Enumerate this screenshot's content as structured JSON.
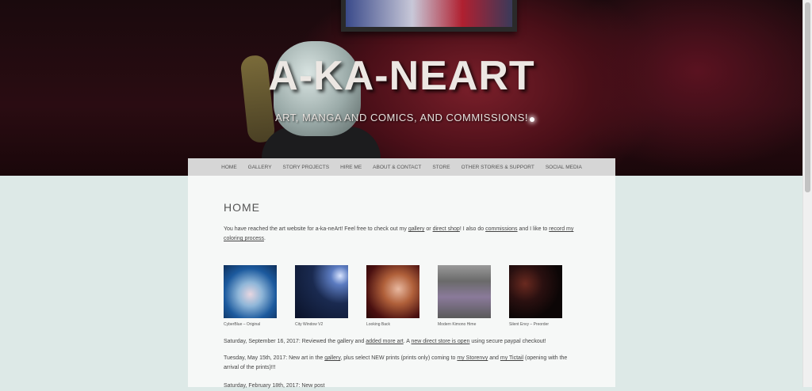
{
  "header": {
    "title": "A-KA-NEART",
    "tagline": "ART, MANGA AND COMICS, AND COMMISSIONS!"
  },
  "nav": {
    "items": [
      {
        "label": "HOME"
      },
      {
        "label": "GALLERY"
      },
      {
        "label": "STORY PROJECTS"
      },
      {
        "label": "HIRE ME"
      },
      {
        "label": "ABOUT & CONTACT"
      },
      {
        "label": "STORE"
      },
      {
        "label": "OTHER STORIES & SUPPORT"
      },
      {
        "label": "SOCIAL MEDIA"
      }
    ]
  },
  "main": {
    "title": "HOME",
    "intro": {
      "t1": "You have reached the art website for a-ka-neArt!  Feel free to check out my ",
      "link_gallery": "gallery",
      "t2": " or ",
      "link_shop": "direct shop",
      "t3": "!  I also do ",
      "link_commissions": "commissions",
      "t4": " and I like to ",
      "link_record": "record my coloring process",
      "t5": "."
    },
    "gallery": [
      {
        "caption": "CyberBlue – Original"
      },
      {
        "caption": "City Window V2"
      },
      {
        "caption": "Looking Back"
      },
      {
        "caption": "Modern Kimono Hime"
      },
      {
        "caption": "Silent Envy – Preorder"
      }
    ],
    "news": [
      {
        "a": "Saturday, September 16, 2017: Reviewed the gallery and ",
        "link1": "added more art",
        "b": ".  A ",
        "link2": "new direct store is open",
        "c": " using secure paypal checkout!"
      },
      {
        "a": "Tuesday, May 15th, 2017: New art in the ",
        "link1": "gallery",
        "b": ", plus select NEW prints (prints only) coming to ",
        "link2": "my Storenvy",
        "c": " and ",
        "link3": "my Tictail",
        "d": " (opening with the arrival of the prints)!!!"
      },
      {
        "a": "Saturday, February 18th, 2017: New post"
      }
    ]
  },
  "colors": {
    "page_bg": "#dde9e7",
    "nav_bg": "#d6d6d6",
    "content_bg": "#f6f8f7",
    "banner_red": "#7a1f2a"
  }
}
